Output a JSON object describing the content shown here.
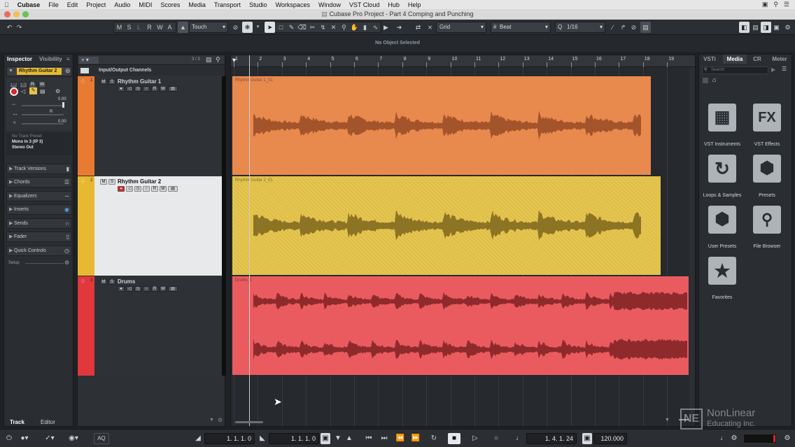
{
  "menubar": {
    "app": "Cubase",
    "items": [
      "File",
      "Edit",
      "Project",
      "Audio",
      "MIDI",
      "Scores",
      "Media",
      "Transport",
      "Studio",
      "Workspaces",
      "Window",
      "VST Cloud",
      "Hub",
      "Help"
    ]
  },
  "window": {
    "title": "Cubase Pro Project - Part 4 Comping and Punching"
  },
  "toolbar": {
    "mode_letters": [
      "M",
      "S",
      "L",
      "R",
      "W",
      "A"
    ],
    "automation_mode": "Touch",
    "snap_type": "Grid",
    "grid_type": "Beat",
    "quantize": "1/16"
  },
  "info_line": {
    "status": "No Object Selected"
  },
  "inspector": {
    "tabs": [
      "Inspector",
      "Visibility"
    ],
    "track_name": "Rhythm Guitar 2",
    "volume": "0.00",
    "pan": "R",
    "pan_value": "0.00",
    "preset": "No Track Preset",
    "input": "Mono In 3 (IP 3)",
    "output": "Stereo Out",
    "sections": [
      "Track Versions",
      "Chords",
      "Equalizers",
      "Inserts",
      "Sends",
      "Fader",
      "Quick Controls"
    ],
    "setup": "Setup",
    "bottom_tabs": [
      "Track",
      "Editor"
    ]
  },
  "tracklist": {
    "count": "3 / 3",
    "folder": "Input/Output Channels",
    "tracks": [
      {
        "name": "Rhythm Guitar 1",
        "number": "1",
        "color": "#e87a32"
      },
      {
        "name": "Rhythm Guitar 2",
        "number": "2",
        "color": "#e7b932"
      },
      {
        "name": "Drums",
        "number": "3",
        "color": "#e0383d"
      }
    ]
  },
  "arrangement": {
    "bars": [
      "1",
      "2",
      "3",
      "4",
      "5",
      "6",
      "7",
      "8",
      "9",
      "10",
      "11",
      "12",
      "13",
      "14",
      "15",
      "16",
      "17",
      "18",
      "19"
    ],
    "events": [
      {
        "name": "Rhythm Guitar 1_01",
        "color": "#e8894e"
      },
      {
        "name": "Rhythm Guitar 2_01",
        "color": "#e5c54e"
      },
      {
        "name": "Drums_1",
        "color": "#ea5b5f"
      }
    ]
  },
  "right_zone": {
    "tabs": [
      "VSTi",
      "Media",
      "CR",
      "Meter"
    ],
    "search_placeholder": "Search",
    "tiles": [
      {
        "label": "VST Instruments",
        "icon": "piano-icon"
      },
      {
        "label": "VST Effects",
        "icon": "fx-icon"
      },
      {
        "label": "Loops & Samples",
        "icon": "loop-icon"
      },
      {
        "label": "Presets",
        "icon": "presets-icon"
      },
      {
        "label": "User Presets",
        "icon": "user-presets-icon"
      },
      {
        "label": "File Browser",
        "icon": "file-browser-icon"
      },
      {
        "label": "Favorites",
        "icon": "star-icon"
      }
    ]
  },
  "transport": {
    "left_locator": "1. 1. 1.   0",
    "right_locator": "1. 1. 1.   0",
    "position": "1. 4. 1. 24",
    "tempo": "120.000",
    "aq": "AQ"
  },
  "watermark": {
    "brand": "NonLinear",
    "sub": "Educating Inc."
  }
}
